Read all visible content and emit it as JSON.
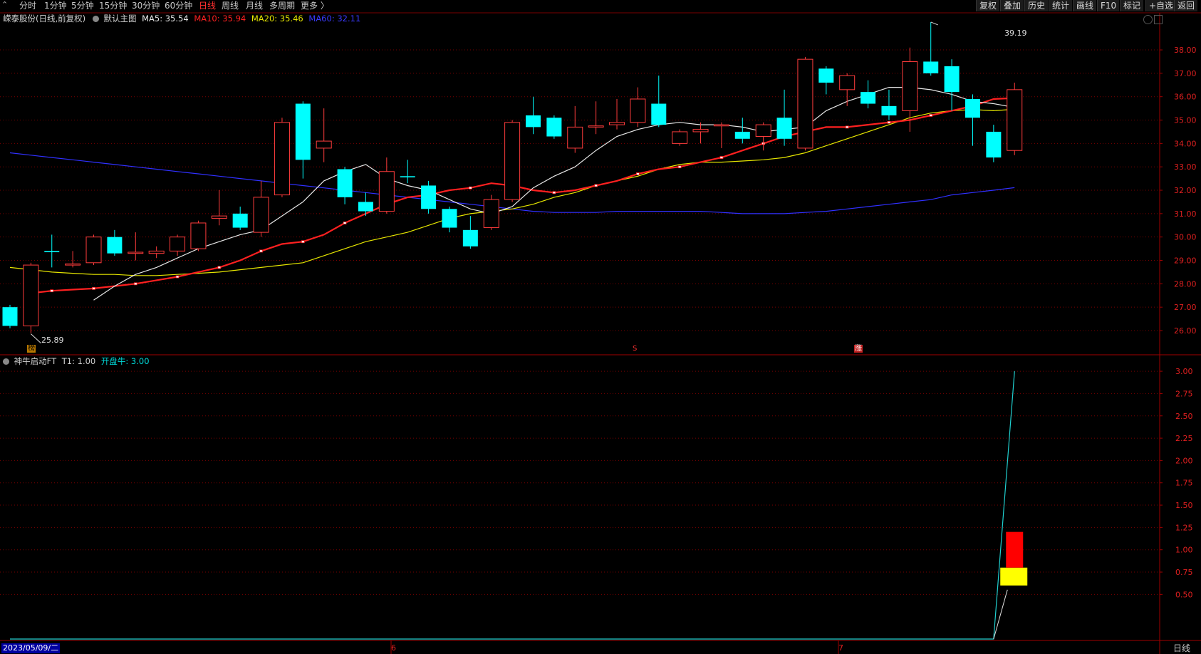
{
  "toolbar": {
    "periods": [
      "分时",
      "1分钟",
      "5分钟",
      "15分钟",
      "30分钟",
      "60分钟",
      "日线",
      "周线",
      "月线",
      "多周期",
      "更多 〉"
    ],
    "active_period": "日线",
    "right_buttons": [
      "复权",
      "叠加",
      "历史",
      "统计",
      "画线",
      "F10",
      "+自选",
      "返回"
    ],
    "mark_label": "标记"
  },
  "main_chart": {
    "stock_title": "嵘泰股份(日线,前复权)",
    "template": "默认主图",
    "ma5": "MA5: 35.54",
    "ma10": "MA10: 35.94",
    "ma20": "MA20: 35.46",
    "ma60": "MA60: 32.11",
    "high_label": "39.19",
    "low_label": "25.89",
    "badges": [
      "榜",
      "S",
      "涨"
    ]
  },
  "sub_chart": {
    "indicator_name": "神牛启动FT",
    "t1": "T1: 1.00",
    "kaipan": "开盘牛: 3.00"
  },
  "bottom_axis": {
    "date_label": "2023/05/09/二",
    "month_marks": [
      "6",
      "7"
    ],
    "period_label": "日线"
  },
  "colors": {
    "up": "#ff3c3c",
    "down": "#00ffff",
    "ma5": "#e6e6e6",
    "ma10": "#ff2020",
    "ma20": "#e6e600",
    "ma60": "#3030ff",
    "grid": "#7a0000",
    "axis_text": "#e02020"
  },
  "chart_data": {
    "type": "candlestick",
    "y_ticks": [
      26,
      27,
      28,
      29,
      30,
      31,
      32,
      33,
      34,
      35,
      36,
      37,
      38
    ],
    "ylim": [
      25.5,
      39.5
    ],
    "candles": [
      {
        "o": 27.0,
        "c": 26.2,
        "h": 27.1,
        "l": 26.1
      },
      {
        "o": 26.2,
        "c": 28.8,
        "h": 28.9,
        "l": 25.89
      },
      {
        "o": 29.4,
        "c": 29.35,
        "h": 30.1,
        "l": 28.7
      },
      {
        "o": 28.8,
        "c": 28.85,
        "h": 29.4,
        "l": 28.7
      },
      {
        "o": 28.9,
        "c": 30.0,
        "h": 30.1,
        "l": 28.8
      },
      {
        "o": 30.0,
        "c": 29.3,
        "h": 30.3,
        "l": 29.2
      },
      {
        "o": 29.3,
        "c": 29.35,
        "h": 30.2,
        "l": 29.0
      },
      {
        "o": 29.3,
        "c": 29.4,
        "h": 29.6,
        "l": 29.1
      },
      {
        "o": 29.4,
        "c": 30.0,
        "h": 30.1,
        "l": 29.2
      },
      {
        "o": 29.5,
        "c": 30.6,
        "h": 30.7,
        "l": 29.4
      },
      {
        "o": 30.8,
        "c": 30.9,
        "h": 32.0,
        "l": 30.5
      },
      {
        "o": 31.0,
        "c": 30.4,
        "h": 31.3,
        "l": 30.3
      },
      {
        "o": 30.2,
        "c": 31.7,
        "h": 32.4,
        "l": 30.0
      },
      {
        "o": 31.8,
        "c": 34.9,
        "h": 35.1,
        "l": 31.7
      },
      {
        "o": 35.7,
        "c": 33.3,
        "h": 35.8,
        "l": 32.5
      },
      {
        "o": 33.8,
        "c": 34.1,
        "h": 35.5,
        "l": 33.2
      },
      {
        "o": 32.9,
        "c": 31.7,
        "h": 33.0,
        "l": 31.4
      },
      {
        "o": 31.5,
        "c": 31.1,
        "h": 31.9,
        "l": 30.9
      },
      {
        "o": 31.1,
        "c": 32.8,
        "h": 33.4,
        "l": 31.0
      },
      {
        "o": 32.6,
        "c": 32.55,
        "h": 33.3,
        "l": 32.3
      },
      {
        "o": 32.2,
        "c": 31.2,
        "h": 32.4,
        "l": 31.0
      },
      {
        "o": 31.2,
        "c": 30.4,
        "h": 31.3,
        "l": 30.2
      },
      {
        "o": 30.3,
        "c": 29.6,
        "h": 30.9,
        "l": 29.5
      },
      {
        "o": 30.4,
        "c": 31.6,
        "h": 31.8,
        "l": 30.3
      },
      {
        "o": 31.6,
        "c": 34.9,
        "h": 35.0,
        "l": 31.5
      },
      {
        "o": 35.2,
        "c": 34.7,
        "h": 36.0,
        "l": 34.4
      },
      {
        "o": 35.1,
        "c": 34.3,
        "h": 35.2,
        "l": 34.2
      },
      {
        "o": 33.8,
        "c": 34.7,
        "h": 35.6,
        "l": 33.6
      },
      {
        "o": 34.7,
        "c": 34.75,
        "h": 35.8,
        "l": 34.4
      },
      {
        "o": 34.8,
        "c": 34.9,
        "h": 35.9,
        "l": 34.6
      },
      {
        "o": 34.9,
        "c": 35.9,
        "h": 36.4,
        "l": 34.7
      },
      {
        "o": 35.7,
        "c": 34.8,
        "h": 36.9,
        "l": 34.7
      },
      {
        "o": 34.0,
        "c": 34.5,
        "h": 34.6,
        "l": 33.9
      },
      {
        "o": 34.5,
        "c": 34.6,
        "h": 34.9,
        "l": 34.0
      },
      {
        "o": 34.75,
        "c": 34.8,
        "h": 34.9,
        "l": 33.8
      },
      {
        "o": 34.5,
        "c": 34.2,
        "h": 35.1,
        "l": 34.0
      },
      {
        "o": 34.3,
        "c": 34.8,
        "h": 34.9,
        "l": 33.7
      },
      {
        "o": 35.1,
        "c": 34.2,
        "h": 36.3,
        "l": 33.9
      },
      {
        "o": 33.8,
        "c": 37.6,
        "h": 37.7,
        "l": 33.7
      },
      {
        "o": 37.2,
        "c": 36.6,
        "h": 37.3,
        "l": 36.1
      },
      {
        "o": 36.3,
        "c": 36.9,
        "h": 37.0,
        "l": 35.6
      },
      {
        "o": 36.2,
        "c": 35.7,
        "h": 36.7,
        "l": 35.5
      },
      {
        "o": 35.6,
        "c": 35.2,
        "h": 36.3,
        "l": 35.0
      },
      {
        "o": 35.4,
        "c": 37.5,
        "h": 38.1,
        "l": 34.5
      },
      {
        "o": 37.5,
        "c": 37.0,
        "h": 39.19,
        "l": 36.9
      },
      {
        "o": 37.3,
        "c": 36.2,
        "h": 37.6,
        "l": 35.4
      },
      {
        "o": 35.9,
        "c": 35.1,
        "h": 36.1,
        "l": 33.9
      },
      {
        "o": 34.5,
        "c": 33.4,
        "h": 34.8,
        "l": 33.2
      },
      {
        "o": 33.7,
        "c": 36.3,
        "h": 36.6,
        "l": 33.5
      }
    ],
    "ma5": [
      null,
      null,
      null,
      null,
      27.3,
      27.9,
      28.4,
      28.7,
      29.1,
      29.5,
      29.8,
      30.1,
      30.3,
      30.9,
      31.5,
      32.4,
      32.8,
      33.1,
      32.5,
      32.2,
      32.0,
      31.6,
      31.2,
      31.0,
      31.3,
      32.1,
      32.6,
      33.0,
      33.7,
      34.3,
      34.6,
      34.8,
      34.9,
      34.8,
      34.8,
      34.7,
      34.5,
      34.6,
      34.7,
      35.4,
      35.8,
      36.1,
      36.4,
      36.4,
      36.3,
      36.1,
      35.8,
      35.7,
      35.54
    ],
    "ma10": [
      null,
      27.6,
      27.7,
      27.75,
      27.8,
      27.9,
      28.0,
      28.15,
      28.3,
      28.5,
      28.7,
      29.0,
      29.4,
      29.7,
      29.8,
      30.1,
      30.6,
      31.0,
      31.4,
      31.7,
      31.8,
      32.0,
      32.1,
      32.3,
      32.2,
      32.0,
      31.9,
      32.0,
      32.2,
      32.4,
      32.7,
      32.9,
      33.0,
      33.2,
      33.4,
      33.7,
      34.0,
      34.3,
      34.5,
      34.7,
      34.7,
      34.8,
      34.9,
      35.0,
      35.2,
      35.4,
      35.6,
      35.9,
      35.94
    ],
    "ma20": [
      28.7,
      28.6,
      28.5,
      28.45,
      28.4,
      28.4,
      28.35,
      28.35,
      28.4,
      28.45,
      28.5,
      28.6,
      28.7,
      28.8,
      28.9,
      29.2,
      29.5,
      29.8,
      30.0,
      30.2,
      30.5,
      30.8,
      31.0,
      31.1,
      31.2,
      31.4,
      31.7,
      31.9,
      32.2,
      32.4,
      32.6,
      32.9,
      33.1,
      33.2,
      33.2,
      33.25,
      33.3,
      33.4,
      33.6,
      33.9,
      34.2,
      34.5,
      34.8,
      35.1,
      35.3,
      35.4,
      35.45,
      35.4,
      35.46
    ],
    "ma60": [
      33.6,
      33.5,
      33.4,
      33.3,
      33.2,
      33.1,
      33.0,
      32.9,
      32.8,
      32.7,
      32.6,
      32.5,
      32.4,
      32.3,
      32.2,
      32.1,
      32.0,
      31.9,
      31.8,
      31.7,
      31.6,
      31.5,
      31.4,
      31.3,
      31.2,
      31.1,
      31.05,
      31.05,
      31.05,
      31.1,
      31.1,
      31.1,
      31.1,
      31.1,
      31.05,
      31.0,
      31.0,
      31.0,
      31.05,
      31.1,
      31.2,
      31.3,
      31.4,
      31.5,
      31.6,
      31.8,
      31.9,
      32.0,
      32.11
    ],
    "sub_y_ticks": [
      0.5,
      0.75,
      1.0,
      1.25,
      1.5,
      1.75,
      2.0,
      2.25,
      2.5,
      2.75,
      3.0
    ],
    "sub_ylim": [
      0,
      3.1
    ],
    "sub_line": {
      "flat_value": 0.0,
      "end_values": [
        0.6,
        3.0
      ]
    },
    "sub_bars": [
      {
        "from": 0.6,
        "to": 0.8,
        "color": "yellow"
      },
      {
        "from": 0.8,
        "to": 1.2,
        "color": "red"
      }
    ]
  }
}
